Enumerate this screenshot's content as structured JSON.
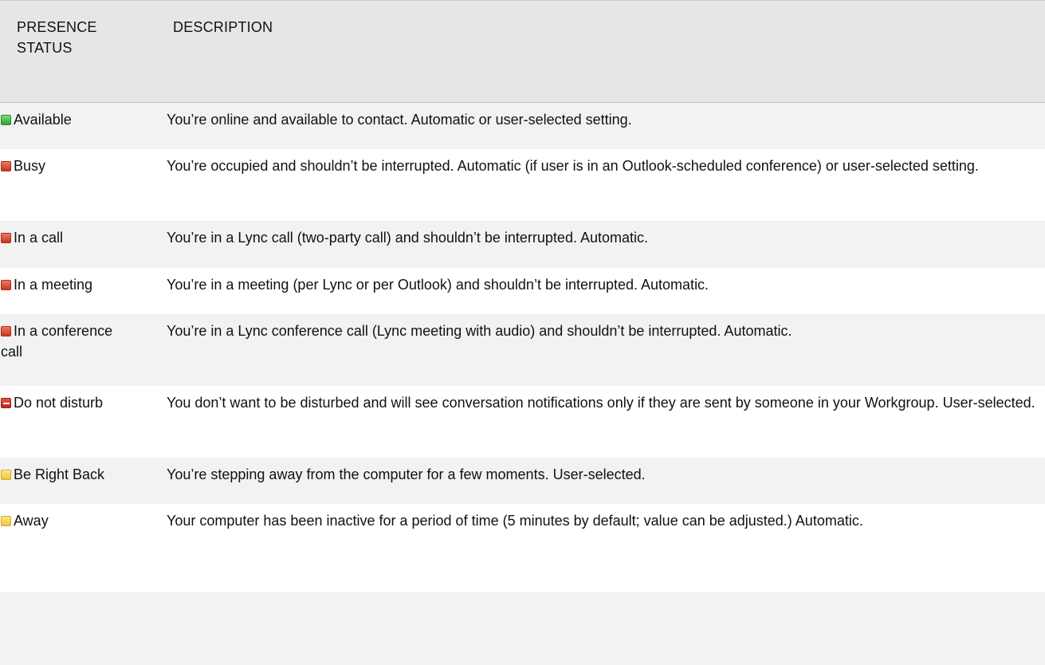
{
  "header": {
    "status_line1": "PRESENCE",
    "status_line2": "STATUS",
    "description": "DESCRIPTION"
  },
  "colors": {
    "header_bg": "#e6e6e6",
    "row_shade": "#f2f2f2",
    "green": "#3cb83c",
    "red": "#d9482f",
    "yellow": "#f3d24a"
  },
  "rows": [
    {
      "status": "Available",
      "icon": "available-status-icon",
      "description": "You’re online and available to contact. Automatic or user-selected setting."
    },
    {
      "status": "Busy",
      "icon": "busy-status-icon",
      "description": "You’re occupied and shouldn’t be interrupted. Automatic (if user is in an Outlook-scheduled conference) or user-selected setting."
    },
    {
      "status": "In a call",
      "icon": "in-a-call-status-icon",
      "description": "You’re in a Lync call (two-party call) and shouldn’t be interrupted. Automatic."
    },
    {
      "status": "In a meeting",
      "icon": "in-a-meeting-status-icon",
      "description": "You’re in a meeting (per Lync or per Outlook) and shouldn’t be interrupted. Automatic."
    },
    {
      "status_line1": "In a conference",
      "status_line2": "call",
      "icon": "in-a-conference-call-status-icon",
      "description": "You’re in a Lync conference call (Lync meeting with audio) and shouldn’t be interrupted. Automatic."
    },
    {
      "status": "Do not disturb",
      "icon": "do-not-disturb-status-icon",
      "description": "You don’t want to be disturbed and will see conversation notifications only if they are sent by someone in your Workgroup. User-selected."
    },
    {
      "status": "Be Right Back",
      "icon": "be-right-back-status-icon",
      "description": "You’re stepping away from the computer for a few moments. User-selected."
    },
    {
      "status": "Away",
      "icon": "away-status-icon",
      "description": "Your computer has been inactive for a period of time (5 minutes by default; value can be adjusted.) Automatic."
    }
  ]
}
